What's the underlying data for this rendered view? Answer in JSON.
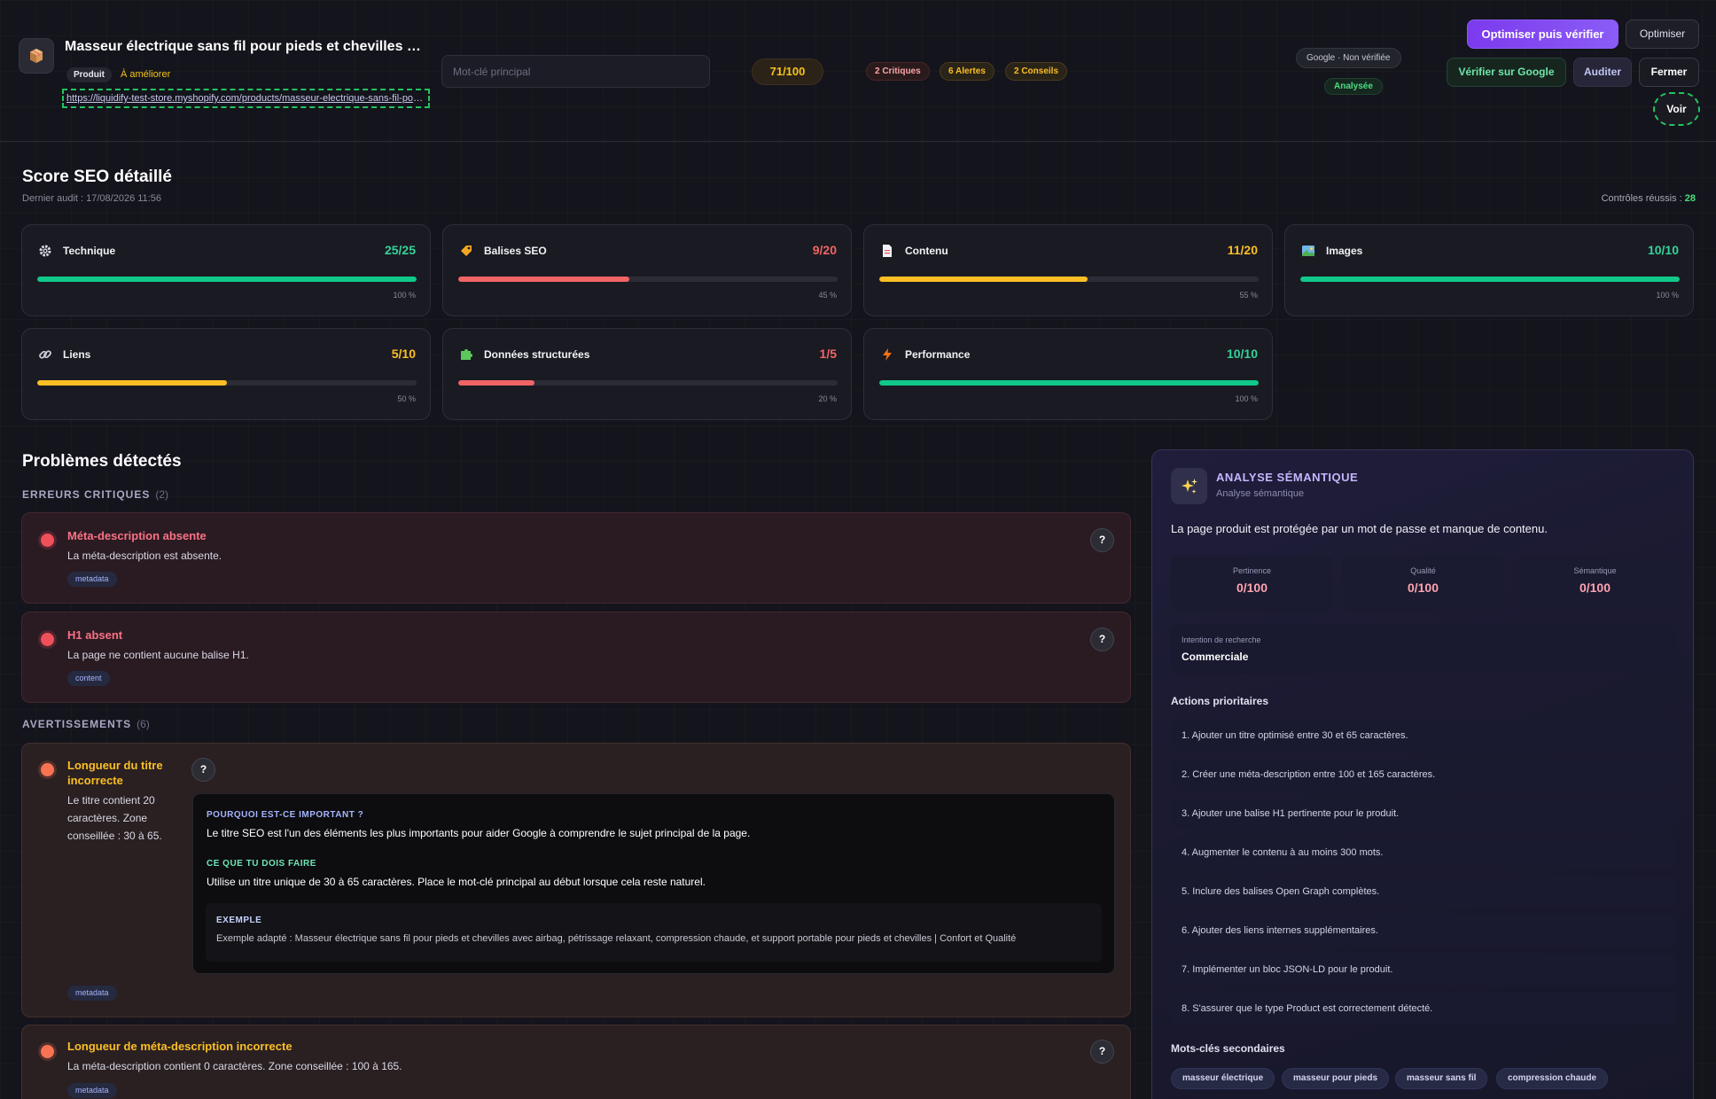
{
  "header": {
    "product_title": "Masseur électrique sans fil pour pieds et chevilles avec airbag, pétrissage relaxant, compression chaude",
    "type_tag": "Produit",
    "status_tag": "À améliorer",
    "url": "https://liquidify-test-store.myshopify.com/products/masseur-electrique-sans-fil-pour-pieds-et-chevilles",
    "keyword_placeholder": "Mot-clé principal",
    "keyword_value": "",
    "score": "71/100",
    "critical_count": "2 Critiques",
    "alert_count": "6 Alertes",
    "tips_count": "2 Conseils",
    "google_status": "Google · Non vérifiée",
    "analysis_status": "Analysée",
    "btn_optimize_verify": "Optimiser puis vérifier",
    "btn_optimize": "Optimiser",
    "btn_verify_google": "Vérifier sur Google",
    "btn_audit": "Auditer",
    "btn_close": "Fermer",
    "btn_view": "Voir"
  },
  "score_section": {
    "title": "Score SEO détaillé",
    "last_audit": "Dernier audit : 17/08/2026 11:56",
    "checks_label": "Contrôles réussis : ",
    "checks_value": "28",
    "categories": [
      {
        "name": "Technique",
        "icon": "gear-icon",
        "score": "25/25",
        "pct": "100 %",
        "fill": 1.0,
        "color": "#10c88a"
      },
      {
        "name": "Balises SEO",
        "icon": "tag-icon",
        "score": "9/20",
        "pct": "45 %",
        "fill": 0.45,
        "color": "#f26464"
      },
      {
        "name": "Contenu",
        "icon": "document-icon",
        "score": "11/20",
        "pct": "55 %",
        "fill": 0.55,
        "color": "#fbbf24"
      },
      {
        "name": "Images",
        "icon": "image-icon",
        "score": "10/10",
        "pct": "100 %",
        "fill": 1.0,
        "color": "#10c88a"
      },
      {
        "name": "Liens",
        "icon": "link-icon",
        "score": "5/10",
        "pct": "50 %",
        "fill": 0.5,
        "color": "#fbbf24"
      },
      {
        "name": "Données structurées",
        "icon": "puzzle-icon",
        "score": "1/5",
        "pct": "20 %",
        "fill": 0.2,
        "color": "#f26464"
      },
      {
        "name": "Performance",
        "icon": "lightning-icon",
        "score": "10/10",
        "pct": "100 %",
        "fill": 1.0,
        "color": "#10c88a"
      }
    ]
  },
  "problems": {
    "title": "Problèmes détectés",
    "critical_group": "ERREURS CRITIQUES",
    "critical_group_count": "(2)",
    "warning_group": "AVERTISSEMENTS",
    "warning_group_count": "(6)",
    "help": "?",
    "items": [
      {
        "title": "Méta-description absente",
        "desc": "La méta-description est absente.",
        "tag": "metadata"
      },
      {
        "title": "H1 absent",
        "desc": "La page ne contient aucune balise H1.",
        "tag": "content"
      },
      {
        "title": "Longueur du titre incorrecte",
        "desc": "Le titre contient 20 caractères. Zone conseillée : 30 à 65.",
        "tag": "metadata",
        "why_label": "POURQUOI EST-CE IMPORTANT ?",
        "why_text": "Le titre SEO est l'un des éléments les plus importants pour aider Google à comprendre le sujet principal de la page.",
        "todo_label": "CE QUE TU DOIS FAIRE",
        "todo_text": "Utilise un titre unique de 30 à 65 caractères. Place le mot-clé principal au début lorsque cela reste naturel.",
        "example_label": "EXEMPLE",
        "example_text": "Exemple adapté : Masseur électrique sans fil pour pieds et chevilles avec airbag, pétrissage relaxant, compression chaude, et support portable pour pieds et chevilles | Confort et Qualité"
      },
      {
        "title": "Longueur de méta-description incorrecte",
        "desc": "La méta-description contient 0 caractères. Zone conseillée : 100 à 165.",
        "tag": "metadata"
      }
    ]
  },
  "semantic": {
    "title": "ANALYSE SÉMANTIQUE",
    "subtitle": "Analyse sémantique",
    "summary": "La page produit est protégée par un mot de passe et manque de contenu.",
    "metrics": [
      {
        "label": "Pertinence",
        "value": "0/100"
      },
      {
        "label": "Qualité",
        "value": "0/100"
      },
      {
        "label": "Sémantique",
        "value": "0/100"
      }
    ],
    "intent_label": "Intention de recherche",
    "intent_value": "Commerciale",
    "actions_title": "Actions prioritaires",
    "actions": [
      "1. Ajouter un titre optimisé entre 30 et 65 caractères.",
      "2. Créer une méta-description entre 100 et 165 caractères.",
      "3. Ajouter une balise H1 pertinente pour le produit.",
      "4. Augmenter le contenu à au moins 300 mots.",
      "5. Inclure des balises Open Graph complètes.",
      "6. Ajouter des liens internes supplémentaires.",
      "7. Implémenter un bloc JSON-LD pour le produit.",
      "8. S'assurer que le type Product est correctement détecté."
    ],
    "keywords_title": "Mots-clés secondaires",
    "keywords": [
      "masseur électrique",
      "masseur pour pieds",
      "masseur sans fil",
      "compression chaude"
    ]
  }
}
